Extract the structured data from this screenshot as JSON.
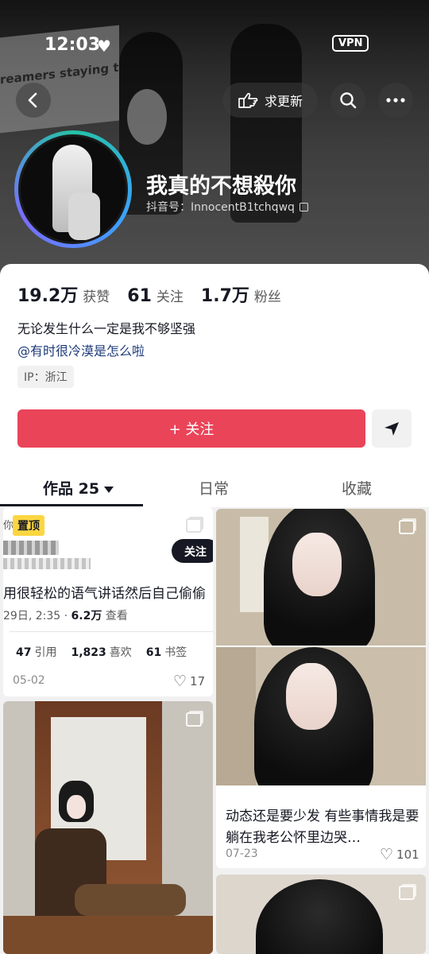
{
  "status_bar": {
    "time": "12:03",
    "heart": "♥",
    "vpn": "VPN"
  },
  "header": {
    "poster_text": "reamers staying together",
    "update_label": "求更新",
    "nickname": "我真的不想殺你",
    "douyin_id": "抖音号：InnocentB1tchqwq"
  },
  "stats": [
    {
      "value": "19.2万",
      "label": "获赞"
    },
    {
      "value": "61",
      "label": "关注"
    },
    {
      "value": "1.7万",
      "label": "粉丝"
    }
  ],
  "bio": {
    "line1": "无论发生什么一定是我不够坚强",
    "mention": "@有时很冷漠是怎么啦",
    "ip": "IP：浙江"
  },
  "actions": {
    "follow_label": "+ 关注"
  },
  "tabs": [
    {
      "label": "作品 25"
    },
    {
      "label": "日常"
    },
    {
      "label": "收藏"
    }
  ],
  "posts": {
    "pinned": {
      "badge": "置顶",
      "prefix": "你",
      "follow": "关注",
      "text": "用很轻松的语气讲话然后自己偷偷",
      "meta_date": "29日, 2:35 · ",
      "meta_views": "6.2万",
      "meta_suffix": " 查看",
      "quotes_n": "47",
      "quotes_l": "引用",
      "likes_n": "1,823",
      "likes_l": "喜欢",
      "bookmarks_n": "61",
      "bookmarks_l": "书签",
      "date": "05-02",
      "likes": "17"
    },
    "second": {},
    "right": {
      "caption": "动态还是要少发 有些事情我是要躺在我老公怀里边哭…",
      "date": "07-23",
      "likes": "101"
    }
  },
  "colors": {
    "accent": "#ea4459",
    "pin": "#fbd641",
    "link": "#1f3b7a"
  }
}
